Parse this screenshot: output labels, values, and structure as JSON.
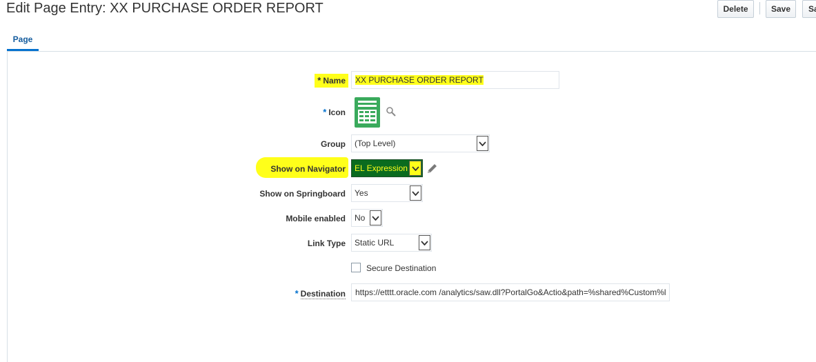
{
  "header": {
    "title": "Edit Page Entry: XX PURCHASE ORDER REPORT"
  },
  "toolbar": {
    "delete_label": "Delete",
    "save_label": "Save",
    "save_and_close_label": "Sa"
  },
  "tabs": [
    {
      "label": "Page",
      "selected": true
    }
  ],
  "form": {
    "required_marker": "*",
    "name": {
      "label": "Name",
      "value": "XX PURCHASE ORDER REPORT"
    },
    "icon": {
      "label": "Icon",
      "icon_name": "spreadsheet-icon"
    },
    "group": {
      "label": "Group",
      "value": "(Top Level)"
    },
    "show_on_navigator": {
      "label": "Show on Navigator",
      "value": "EL Expression"
    },
    "show_on_springboard": {
      "label": "Show on Springboard",
      "value": "Yes"
    },
    "mobile_enabled": {
      "label": "Mobile enabled",
      "value": "No"
    },
    "link_type": {
      "label": "Link Type",
      "value": "Static URL"
    },
    "secure_destination": {
      "label": "Secure Destination",
      "checked": false
    },
    "destination": {
      "label": "Destination",
      "value": "https://etttt.oracle.com /analytics/saw.dll?PortalGo&Actio&path=%shared%Custom%l"
    }
  },
  "colors": {
    "highlight": "#ffff1a",
    "accent": "#0572ce",
    "icon_green": "#3aaa5c",
    "el_bg": "#0a6b1f"
  }
}
